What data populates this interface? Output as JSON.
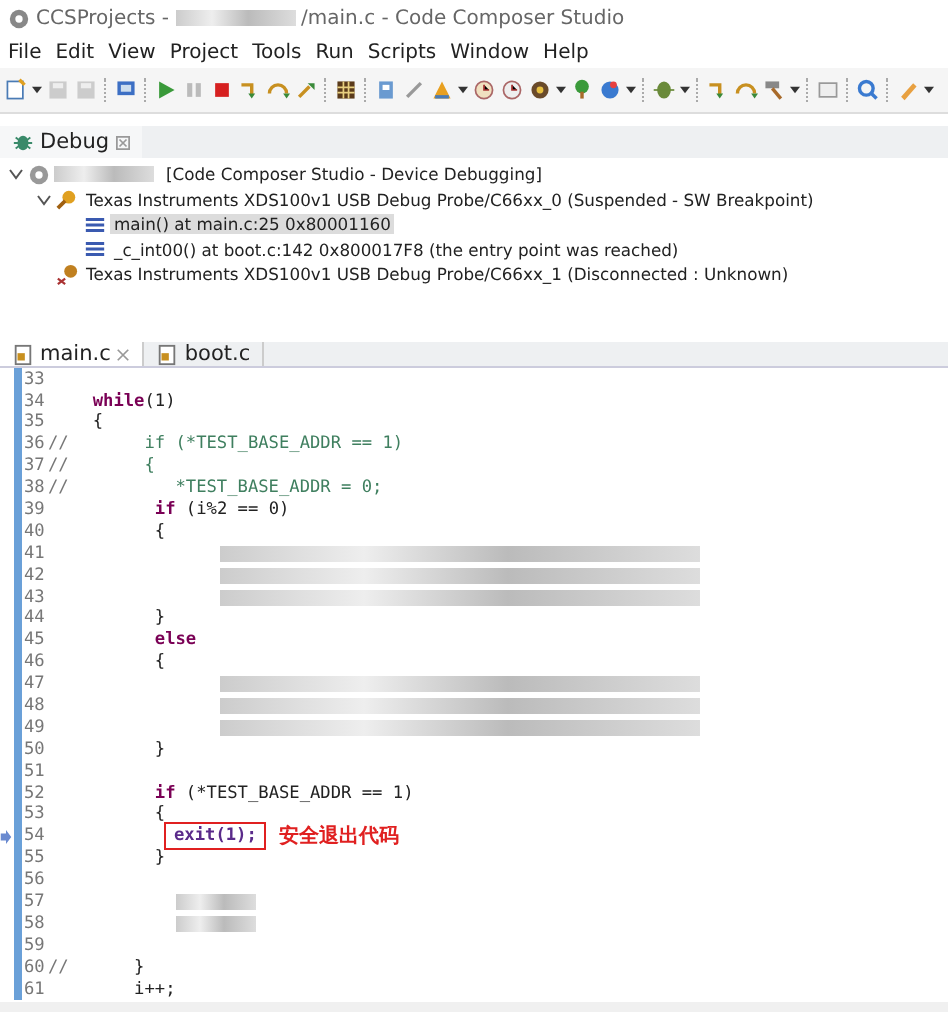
{
  "window": {
    "title_start": "CCSProjects - ",
    "title_end": "/main.c - Code Composer Studio"
  },
  "menu": [
    "File",
    "Edit",
    "View",
    "Project",
    "Tools",
    "Run",
    "Scripts",
    "Window",
    "Help"
  ],
  "debug_view": {
    "title": "Debug",
    "tree": [
      {
        "label": "[Code Composer Studio - Device Debugging]",
        "kind": "session",
        "expanded": true,
        "selected": false,
        "children": [
          {
            "label": "Texas Instruments XDS100v1 USB Debug Probe/C66xx_0 (Suspended - SW Breakpoint)",
            "kind": "probe",
            "expanded": true,
            "selected": false,
            "children": [
              {
                "label": "main() at main.c:25 0x80001160",
                "kind": "frame",
                "selected": true
              },
              {
                "label": "_c_int00() at boot.c:142 0x800017F8  (the entry point was reached)",
                "kind": "frame",
                "selected": false
              }
            ]
          },
          {
            "label": "Texas Instruments XDS100v1 USB Debug Probe/C66xx_1 (Disconnected : Unknown)",
            "kind": "probe_off",
            "selected": false
          }
        ]
      }
    ]
  },
  "editor": {
    "tabs": [
      {
        "label": "main.c",
        "selected": true
      },
      {
        "label": "boot.c",
        "selected": false
      }
    ],
    "lines": [
      {
        "num": "33"
      },
      {
        "num": "34",
        "segments": [
          {
            "kind": "keyword",
            "text": "  while"
          },
          {
            "kind": "plain",
            "text": "(1)"
          }
        ]
      },
      {
        "num": "35",
        "segments": [
          {
            "kind": "plain",
            "text": "  {"
          }
        ]
      },
      {
        "num": "36",
        "comment_mark": "//",
        "segments": [
          {
            "kind": "comment",
            "text": "       if (*TEST_BASE_ADDR == 1)"
          }
        ]
      },
      {
        "num": "37",
        "comment_mark": "//",
        "segments": [
          {
            "kind": "comment",
            "text": "       {"
          }
        ]
      },
      {
        "num": "38",
        "comment_mark": "//",
        "segments": [
          {
            "kind": "comment",
            "text": "          *TEST_BASE_ADDR = 0;"
          }
        ]
      },
      {
        "num": "39",
        "segments": [
          {
            "kind": "keyword",
            "text": "        if"
          },
          {
            "kind": "plain",
            "text": " (i%2 == 0)"
          }
        ]
      },
      {
        "num": "40",
        "segments": [
          {
            "kind": "plain",
            "text": "        {"
          }
        ]
      },
      {
        "num": "41",
        "segments": [
          {
            "kind": "redacted"
          }
        ]
      },
      {
        "num": "42",
        "segments": [
          {
            "kind": "redacted"
          }
        ]
      },
      {
        "num": "43",
        "segments": [
          {
            "kind": "redacted"
          }
        ]
      },
      {
        "num": "44",
        "segments": [
          {
            "kind": "plain",
            "text": "        }"
          }
        ]
      },
      {
        "num": "45",
        "segments": [
          {
            "kind": "keyword",
            "text": "        else"
          }
        ]
      },
      {
        "num": "46",
        "segments": [
          {
            "kind": "plain",
            "text": "        {"
          }
        ]
      },
      {
        "num": "47",
        "segments": [
          {
            "kind": "redacted"
          }
        ]
      },
      {
        "num": "48",
        "segments": [
          {
            "kind": "redacted"
          }
        ]
      },
      {
        "num": "49",
        "segments": [
          {
            "kind": "redacted"
          }
        ]
      },
      {
        "num": "50",
        "segments": [
          {
            "kind": "plain",
            "text": "        }"
          }
        ]
      },
      {
        "num": "51"
      },
      {
        "num": "52",
        "segments": [
          {
            "kind": "keyword",
            "text": "        if"
          },
          {
            "kind": "plain",
            "text": " (*TEST_BASE_ADDR == 1)"
          }
        ]
      },
      {
        "num": "53",
        "segments": [
          {
            "kind": "plain",
            "text": "        {"
          }
        ]
      },
      {
        "num": "54",
        "current": true,
        "segments": [
          {
            "kind": "boxed",
            "text": "exit(1);"
          },
          {
            "kind": "note",
            "text": "安全退出代码"
          }
        ]
      },
      {
        "num": "55",
        "segments": [
          {
            "kind": "plain",
            "text": "        }"
          }
        ]
      },
      {
        "num": "56"
      },
      {
        "num": "57",
        "segments": [
          {
            "kind": "redacted_short"
          }
        ]
      },
      {
        "num": "58",
        "segments": [
          {
            "kind": "redacted_short"
          }
        ]
      },
      {
        "num": "59"
      },
      {
        "num": "60",
        "comment_mark": "//",
        "segments": [
          {
            "kind": "plain",
            "text": "      }"
          }
        ]
      },
      {
        "num": "61",
        "segments": [
          {
            "kind": "plain",
            "text": "      i++;"
          }
        ]
      }
    ]
  }
}
